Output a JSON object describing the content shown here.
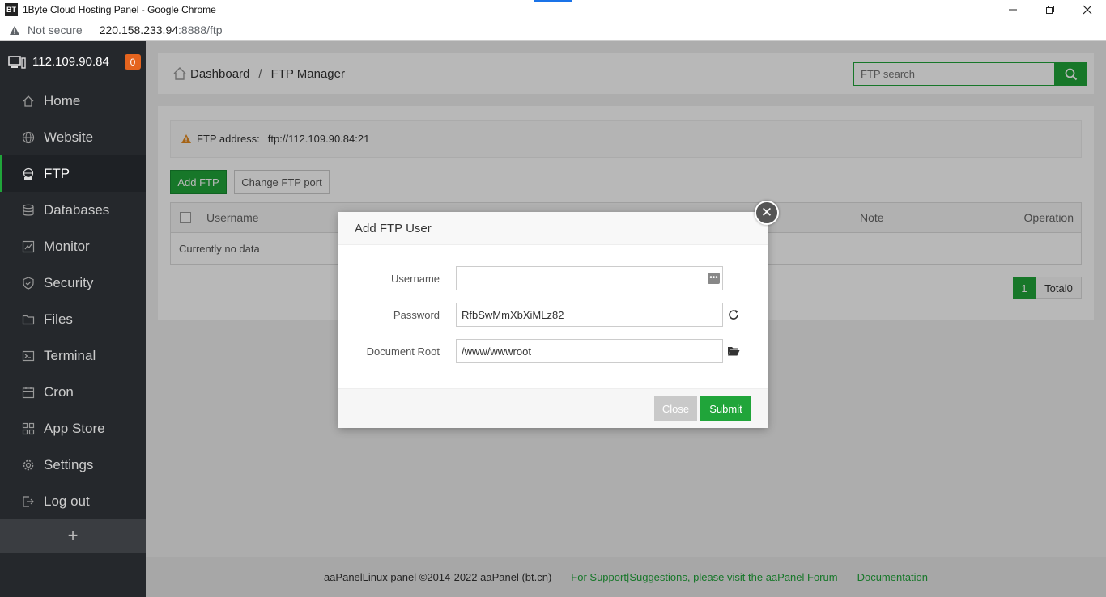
{
  "browser": {
    "logo": "BT",
    "window_title": "1Byte Cloud Hosting Panel - Google Chrome",
    "security_label": "Not secure",
    "url_host": "220.158.233.94",
    "url_path": ":8888/ftp",
    "controls": [
      "minimize-icon",
      "restore-icon",
      "close-icon"
    ]
  },
  "sidebar": {
    "server_ip": "112.109.90.84",
    "badge": "0",
    "items": [
      {
        "label": "Home",
        "icon": "home-icon"
      },
      {
        "label": "Website",
        "icon": "globe-icon"
      },
      {
        "label": "FTP",
        "icon": "ftp-icon",
        "active": true
      },
      {
        "label": "Databases",
        "icon": "database-icon"
      },
      {
        "label": "Monitor",
        "icon": "monitor-icon"
      },
      {
        "label": "Security",
        "icon": "shield-icon"
      },
      {
        "label": "Files",
        "icon": "folder-icon"
      },
      {
        "label": "Terminal",
        "icon": "terminal-icon"
      },
      {
        "label": "Cron",
        "icon": "calendar-icon"
      },
      {
        "label": "App Store",
        "icon": "grid-icon"
      },
      {
        "label": "Settings",
        "icon": "gear-icon"
      },
      {
        "label": "Log out",
        "icon": "logout-icon"
      }
    ],
    "add_symbol": "+"
  },
  "header": {
    "breadcrumb": [
      "Dashboard",
      "FTP Manager"
    ],
    "breadcrumb_sep": "/",
    "search_placeholder": "FTP search"
  },
  "panel": {
    "ftp_address_label": "FTP address:",
    "ftp_address_value": "ftp://112.109.90.84:21",
    "add_button": "Add FTP",
    "port_button": "Change FTP port",
    "columns": {
      "username": "Username",
      "note": "Note",
      "operation": "Operation"
    },
    "empty_text": "Currently no data",
    "pager_current": "1",
    "pager_total": "Total0"
  },
  "footer": {
    "copyright": "aaPanelLinux panel ©2014-2022 aaPanel (bt.cn)",
    "support": "For Support|Suggestions, please visit the aaPanel Forum",
    "docs": "Documentation"
  },
  "modal": {
    "title": "Add FTP User",
    "close_symbol": "✕",
    "username_label": "Username",
    "username_value": "",
    "password_label": "Password",
    "password_value": "RfbSwMmXbXiMLz82",
    "root_label": "Document Root",
    "root_value": "/www/wwwroot",
    "close_button": "Close",
    "submit_button": "Submit"
  },
  "colors": {
    "accent": "#20a53a",
    "badge": "#e5641e",
    "sidebar_bg": "#25282c"
  }
}
